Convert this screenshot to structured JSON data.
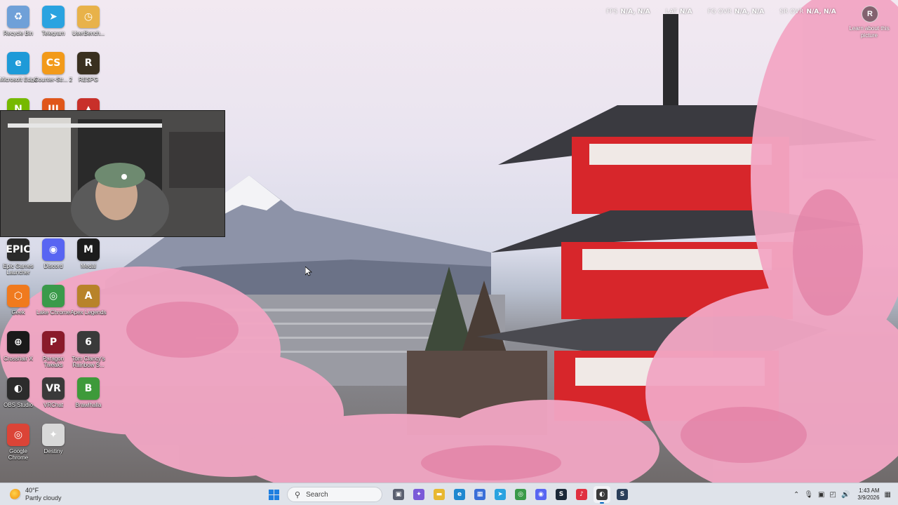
{
  "desktop": {
    "icons": [
      {
        "label": "Recycle Bin",
        "icon": "recycle-bin-icon",
        "color": "#6fa0d8",
        "glyph": "♻"
      },
      {
        "label": "Telegram",
        "icon": "telegram-icon",
        "color": "#2aa3e0",
        "glyph": "➤"
      },
      {
        "label": "UserBench...",
        "icon": "userbenchmark-icon",
        "color": "#e8b24a",
        "glyph": "◷"
      },
      {
        "label": "Microsoft Edge",
        "icon": "edge-icon",
        "color": "#1e9ad8",
        "glyph": "e"
      },
      {
        "label": "Counter-Str... 2",
        "icon": "counter-strike-icon",
        "color": "#f29a1a",
        "glyph": "CS"
      },
      {
        "label": "RESPG",
        "icon": "respg-icon",
        "color": "#3a3020",
        "glyph": "R"
      },
      {
        "label": "",
        "icon": "nvidia-icon",
        "color": "#76b900",
        "glyph": "N"
      },
      {
        "label": "",
        "icon": "black-ops-icon",
        "color": "#e0561a",
        "glyph": "III"
      },
      {
        "label": "",
        "icon": "red-app-icon",
        "color": "#c8302a",
        "glyph": "▲"
      },
      {
        "label": "Epic Games Launcher",
        "icon": "epic-games-icon",
        "color": "#2a2a2a",
        "glyph": "EPIC"
      },
      {
        "label": "Discord",
        "icon": "discord-icon",
        "color": "#5865f2",
        "glyph": "◉"
      },
      {
        "label": "Medal",
        "icon": "medal-icon",
        "color": "#1c1c1c",
        "glyph": "M"
      },
      {
        "label": "Geek",
        "icon": "geek-icon",
        "color": "#f07a1e",
        "glyph": "⬡"
      },
      {
        "label": "Lake Chrome",
        "icon": "chrome-icon",
        "color": "#3a9a4a",
        "glyph": "◎"
      },
      {
        "label": "Apex Legends",
        "icon": "apex-legends-icon",
        "color": "#b8832a",
        "glyph": "A"
      },
      {
        "label": "Crosshair X",
        "icon": "crosshair-icon",
        "color": "#1a1a1a",
        "glyph": "⊕"
      },
      {
        "label": "Paragon Tweaks",
        "icon": "paragon-icon",
        "color": "#8a1a2a",
        "glyph": "P"
      },
      {
        "label": "Tom Clancy's Rainbow S...",
        "icon": "rainbow-six-icon",
        "color": "#3a3a3a",
        "glyph": "6"
      },
      {
        "label": "OBS Studio",
        "icon": "obs-icon",
        "color": "#2b2b2b",
        "glyph": "◐"
      },
      {
        "label": "VRChat",
        "icon": "vrchat-icon",
        "color": "#3a3a3a",
        "glyph": "VR"
      },
      {
        "label": "Brawlhalla",
        "icon": "brawlhalla-icon",
        "color": "#3e9a3a",
        "glyph": "B"
      },
      {
        "label": "Google Chrome",
        "icon": "google-chrome-icon",
        "color": "#db4437",
        "glyph": "◎"
      },
      {
        "label": "Destiny",
        "icon": "destiny-icon",
        "color": "#d8d8d8",
        "glyph": "✦"
      }
    ]
  },
  "overlay": {
    "stats": [
      {
        "key": "FPS",
        "value": "N/A, N/A"
      },
      {
        "key": "LAT",
        "value": "N/A"
      },
      {
        "key": "FG OVR",
        "value": "N/A, N/A"
      },
      {
        "key": "SR OVR",
        "value": "N/A, N/A"
      }
    ],
    "learn_picture": "Learn about this picture"
  },
  "taskbar": {
    "weather": {
      "temp": "40°F",
      "condition": "Partly cloudy"
    },
    "search_placeholder": "Search",
    "apps": [
      {
        "name": "task-view-icon",
        "color": "#5a6070",
        "glyph": "▣"
      },
      {
        "name": "copilot-icon",
        "color": "#7a5ad8",
        "glyph": "✦"
      },
      {
        "name": "file-explorer-icon",
        "color": "#e8b830",
        "glyph": "▬"
      },
      {
        "name": "edge-icon",
        "color": "#1e88d0",
        "glyph": "e"
      },
      {
        "name": "microsoft-store-icon",
        "color": "#3a6fd8",
        "glyph": "▦"
      },
      {
        "name": "telegram-icon",
        "color": "#2aa3e0",
        "glyph": "➤"
      },
      {
        "name": "chrome-icon",
        "color": "#3a9a4a",
        "glyph": "◎"
      },
      {
        "name": "discord-icon",
        "color": "#5865f2",
        "glyph": "◉"
      },
      {
        "name": "steam-icon",
        "color": "#1b2838",
        "glyph": "S"
      },
      {
        "name": "music-app-icon",
        "color": "#e03040",
        "glyph": "♪"
      },
      {
        "name": "obs-icon",
        "color": "#3a3a3a",
        "glyph": "◐"
      },
      {
        "name": "steam-client-icon",
        "color": "#2a3f5a",
        "glyph": "S"
      }
    ],
    "active_app_index": 10,
    "clock": {
      "time": "1:43 AM",
      "date": "3/9/2026"
    }
  }
}
